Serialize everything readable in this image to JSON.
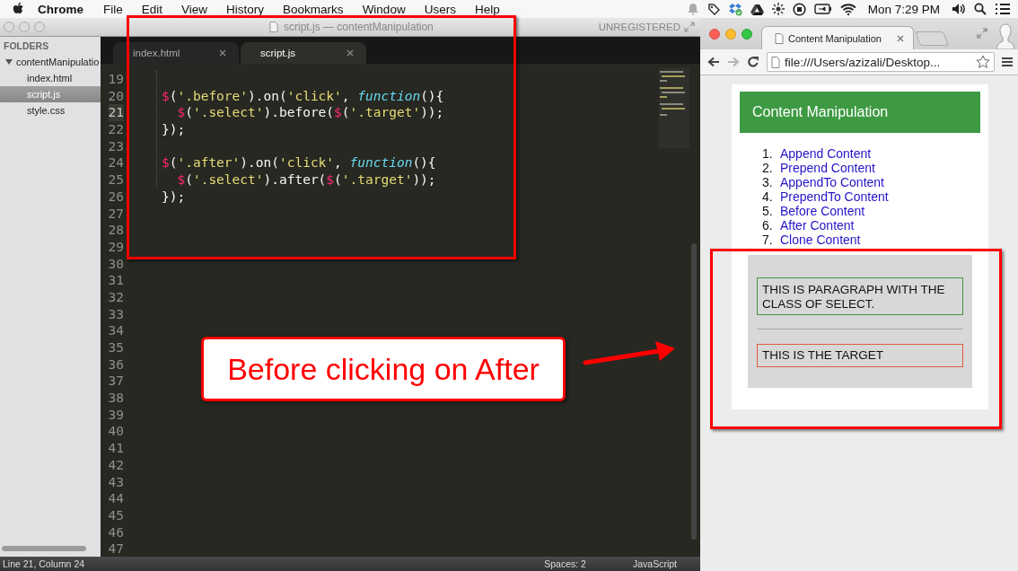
{
  "menu_bar": {
    "app": "Chrome",
    "menus": [
      "File",
      "Edit",
      "View",
      "History",
      "Bookmarks",
      "Window",
      "Users",
      "Help"
    ],
    "clock": "Mon 7:29 PM"
  },
  "editor": {
    "title": "script.js — contentManipulation",
    "license": "UNREGISTERED",
    "sidebar": {
      "heading": "FOLDERS",
      "tree": [
        {
          "label": "contentManipulatio",
          "expanded": true,
          "selected": false,
          "children": [
            {
              "label": "index.html",
              "selected": false
            },
            {
              "label": "script.js",
              "selected": true
            },
            {
              "label": "style.css",
              "selected": false
            }
          ]
        }
      ]
    },
    "tabs": [
      {
        "label": "index.html",
        "selected": false
      },
      {
        "label": "script.js",
        "selected": true
      }
    ],
    "lines": [
      {
        "number": "19",
        "current": false
      },
      {
        "number": "20",
        "current": false,
        "tokens": [
          {
            "kind": "dollar",
            "text": "$"
          },
          {
            "kind": "plain",
            "text": "("
          },
          {
            "kind": "string",
            "text": "'.before'"
          },
          {
            "kind": "plain",
            "text": ").on("
          },
          {
            "kind": "string",
            "text": "'click'"
          },
          {
            "kind": "plain",
            "text": ", "
          },
          {
            "kind": "keyword",
            "text": "function"
          },
          {
            "kind": "plain",
            "text": "(){"
          }
        ]
      },
      {
        "number": "21",
        "current": true,
        "indented": true,
        "tokens": [
          {
            "kind": "dollar",
            "text": "$"
          },
          {
            "kind": "plain",
            "text": "("
          },
          {
            "kind": "string",
            "text": "'.select'"
          },
          {
            "kind": "plain",
            "text": ").before("
          },
          {
            "kind": "dollar",
            "text": "$"
          },
          {
            "kind": "plain",
            "text": "("
          },
          {
            "kind": "string",
            "text": "'.target'"
          },
          {
            "kind": "plain",
            "text": "));"
          }
        ]
      },
      {
        "number": "22",
        "current": false,
        "tokens": [
          {
            "kind": "plain",
            "text": "});"
          }
        ]
      },
      {
        "number": "23",
        "current": false
      },
      {
        "number": "24",
        "current": false,
        "tokens": [
          {
            "kind": "dollar",
            "text": "$"
          },
          {
            "kind": "plain",
            "text": "("
          },
          {
            "kind": "string",
            "text": "'.after'"
          },
          {
            "kind": "plain",
            "text": ").on("
          },
          {
            "kind": "string",
            "text": "'click'"
          },
          {
            "kind": "plain",
            "text": ", "
          },
          {
            "kind": "keyword",
            "text": "function"
          },
          {
            "kind": "plain",
            "text": "(){"
          }
        ]
      },
      {
        "number": "25",
        "current": false,
        "indented": true,
        "tokens": [
          {
            "kind": "dollar",
            "text": "$"
          },
          {
            "kind": "plain",
            "text": "("
          },
          {
            "kind": "string",
            "text": "'.select'"
          },
          {
            "kind": "plain",
            "text": ").after("
          },
          {
            "kind": "dollar",
            "text": "$"
          },
          {
            "kind": "plain",
            "text": "("
          },
          {
            "kind": "string",
            "text": "'.target'"
          },
          {
            "kind": "plain",
            "text": "));"
          }
        ]
      },
      {
        "number": "26",
        "current": false,
        "tokens": [
          {
            "kind": "plain",
            "text": "});"
          }
        ]
      },
      {
        "number": "27",
        "current": false
      },
      {
        "number": "28",
        "current": false
      },
      {
        "number": "29",
        "current": false
      },
      {
        "number": "30",
        "current": false
      },
      {
        "number": "31",
        "current": false
      },
      {
        "number": "32",
        "current": false
      },
      {
        "number": "33",
        "current": false
      },
      {
        "number": "34",
        "current": false
      },
      {
        "number": "35",
        "current": false
      },
      {
        "number": "36",
        "current": false
      },
      {
        "number": "37",
        "current": false
      },
      {
        "number": "38",
        "current": false
      },
      {
        "number": "39",
        "current": false
      },
      {
        "number": "40",
        "current": false
      },
      {
        "number": "41",
        "current": false
      },
      {
        "number": "42",
        "current": false
      },
      {
        "number": "43",
        "current": false
      },
      {
        "number": "44",
        "current": false
      },
      {
        "number": "45",
        "current": false
      },
      {
        "number": "46",
        "current": false
      },
      {
        "number": "47",
        "current": false
      }
    ],
    "status_bar": {
      "position": "Line 21, Column 24",
      "indentation": "Spaces: 2",
      "syntax": "JavaScript"
    }
  },
  "browser": {
    "tabs": [
      {
        "title": "Content Manipulation",
        "selected": true
      }
    ],
    "url": "file:///Users/azizali/Desktop...",
    "page": {
      "heading": "Content Manipulation",
      "links": [
        {
          "number": "1.",
          "label": "Append Content"
        },
        {
          "number": "2.",
          "label": "Prepend Content"
        },
        {
          "number": "3.",
          "label": "AppendTo Content"
        },
        {
          "number": "4.",
          "label": "PrependTo Content"
        },
        {
          "number": "5.",
          "label": "Before Content"
        },
        {
          "number": "6.",
          "label": "After Content"
        },
        {
          "number": "7.",
          "label": "Clone Content"
        }
      ],
      "demo": [
        {
          "kind": "select",
          "text": "THIS IS PARAGRAPH WITH THE CLASS OF SELECT."
        },
        {
          "kind": "rule"
        },
        {
          "kind": "target",
          "text": "THIS IS THE TARGET"
        }
      ]
    }
  },
  "annotation": {
    "callout": "Before clicking on After"
  }
}
